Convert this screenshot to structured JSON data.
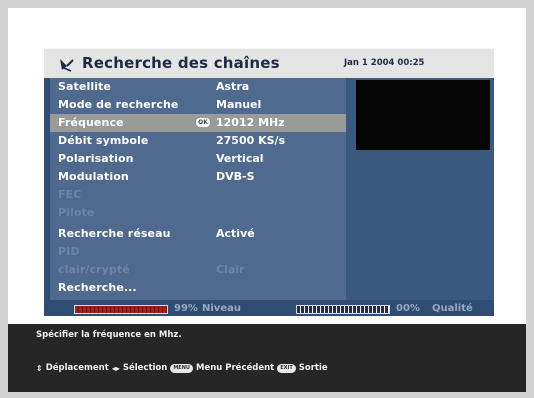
{
  "header": {
    "title": "Recherche des chaînes",
    "datetime": "Jan 1 2004 00:25",
    "icon": "satellite-dish-icon"
  },
  "menu": {
    "items": [
      {
        "label": "Satellite",
        "value": "Astra",
        "enabled": true
      },
      {
        "label": "Mode de recherche",
        "value": "Manuel",
        "enabled": true
      },
      {
        "label": "Fréquence",
        "value": "12012 MHz",
        "enabled": true,
        "selected": true
      },
      {
        "label": "Débit symbole",
        "value": "27500 KS/s",
        "enabled": true
      },
      {
        "label": "Polarisation",
        "value": "Vertical",
        "enabled": true
      },
      {
        "label": "Modulation",
        "value": "DVB-S",
        "enabled": true
      },
      {
        "label": "FEC",
        "value": "",
        "enabled": false
      },
      {
        "label": "Pilote",
        "value": "",
        "enabled": false
      },
      {
        "label": "Recherche réseau",
        "value": "Activé",
        "enabled": true
      },
      {
        "label": "PID",
        "value": "",
        "enabled": false
      },
      {
        "label": "clair/crypté",
        "value": "Clair",
        "enabled": false
      },
      {
        "label": "Recherche...",
        "value": "",
        "enabled": true
      }
    ],
    "ok_badge": "OK"
  },
  "signal": {
    "level_percent": "99%",
    "level_label": "Niveau",
    "level_value": 0.99,
    "quality_percent": "00%",
    "quality_label": "Qualité",
    "quality_value": 0.0
  },
  "help": {
    "text": "Spécifier la fréquence en Mhz.",
    "nav": {
      "move_label": "Déplacement",
      "select_label": "Sélection",
      "menu_key": "MENU",
      "menu_label": "Menu Précédent",
      "exit_key": "EXIT",
      "exit_label": "Sortie"
    }
  },
  "colors": {
    "panel_bg": "#2f4d74",
    "list_bg": "#50698f",
    "selected_bg": "#9a9a96",
    "level_bar": "#b51a1a"
  }
}
